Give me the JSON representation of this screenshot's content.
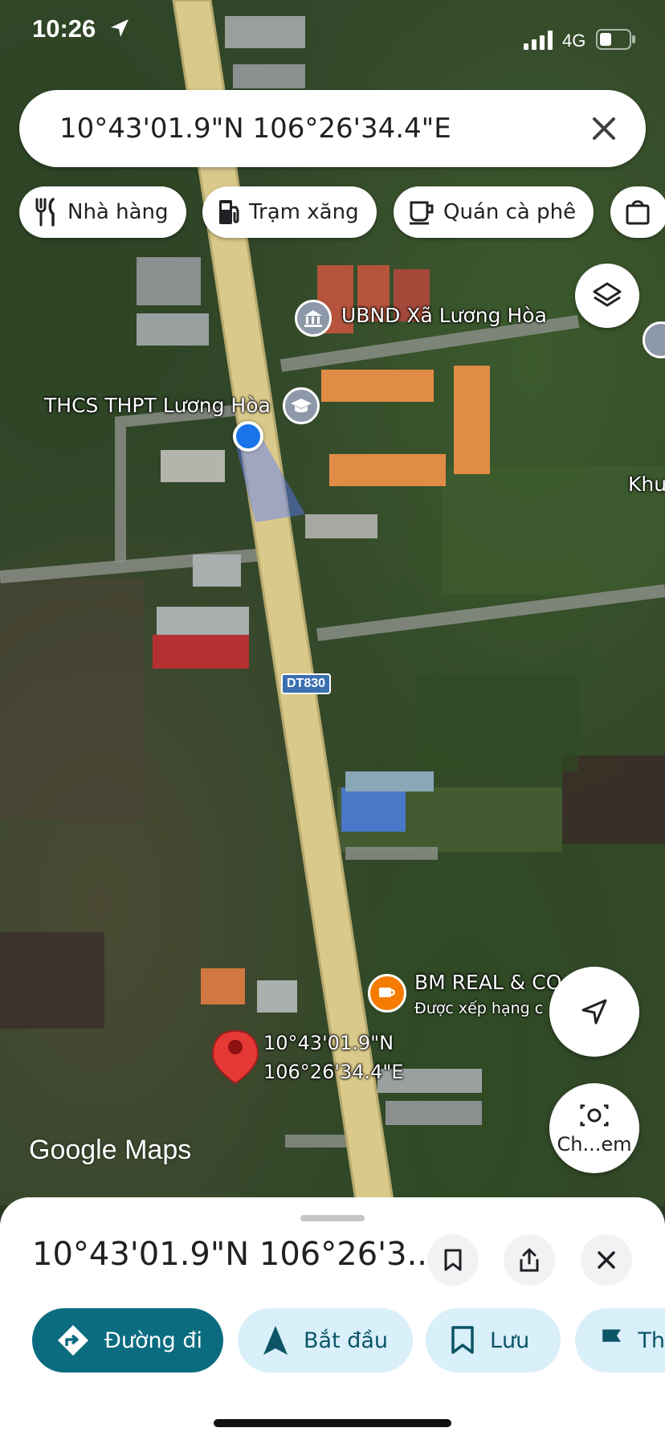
{
  "status_bar": {
    "time": "10:26",
    "network": "4G"
  },
  "search": {
    "query": "10°43'01.9\"N 106°26'34.4\"E"
  },
  "chips": [
    {
      "label": "Nhà hàng",
      "icon": "restaurant-icon"
    },
    {
      "label": "Trạm xăng",
      "icon": "gas-station-icon"
    },
    {
      "label": "Quán cà phê",
      "icon": "coffee-icon"
    },
    {
      "label": "",
      "icon": "shopping-bag-icon"
    }
  ],
  "map": {
    "poi": {
      "ubnd": "UBND Xã Lương Hòa",
      "school": "THCS THPT Lương Hòa",
      "partial_right": "Khu",
      "bm_real": "BM REAL & CO",
      "bm_real_sub": "Được xếp hạng c"
    },
    "road_shield": "DT830",
    "pin_lat": "10°43'01.9\"N",
    "pin_lng": "106°26'34.4\"E",
    "logo": "Google Maps",
    "camera_label": "Ch...em"
  },
  "sheet": {
    "title": "10°43'01.9\"N 106°26'3...",
    "actions": [
      {
        "label": "Đường đi",
        "icon": "directions-icon",
        "style": "primary"
      },
      {
        "label": "Bắt đầu",
        "icon": "navigation-arrow-icon",
        "style": "secondary"
      },
      {
        "label": "Lưu",
        "icon": "bookmark-icon",
        "style": "secondary"
      },
      {
        "label": "Th",
        "icon": "flag-icon",
        "style": "secondary"
      }
    ]
  },
  "colors": {
    "primary": "#0b6c80",
    "secondary": "#d9effa",
    "road": "#d9c98a",
    "pin": "#e53935",
    "location": "#1a73e8"
  }
}
